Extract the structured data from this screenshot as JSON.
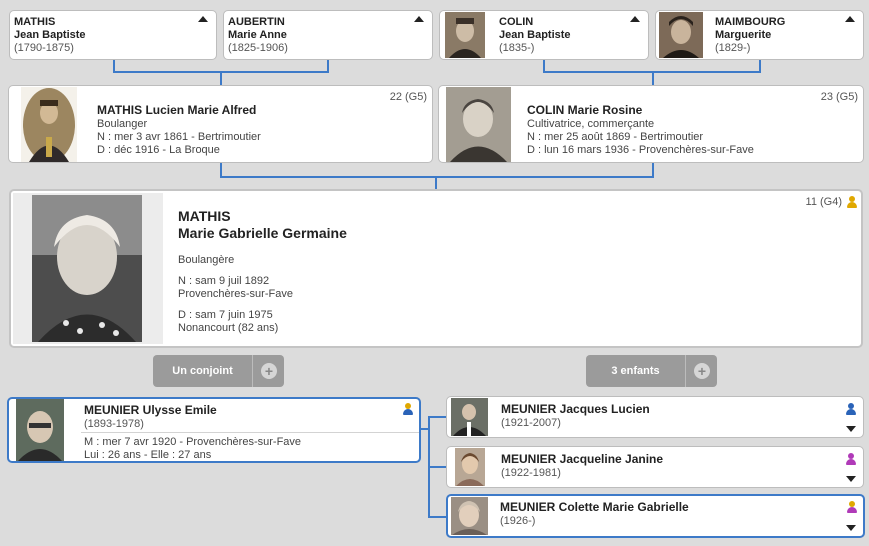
{
  "grandparents": [
    {
      "surname": "MATHIS",
      "given": "Jean Baptiste",
      "dates": "(1790-1875)"
    },
    {
      "surname": "AUBERTIN",
      "given": "Marie Anne",
      "dates": "(1825-1906)"
    },
    {
      "surname": "COLIN",
      "given": "Jean Baptiste",
      "dates": "(1835-)"
    },
    {
      "surname": "MAIMBOURG",
      "given": "Marguerite",
      "dates": "(1829-)"
    }
  ],
  "father": {
    "name": "MATHIS Lucien Marie Alfred",
    "occupation": "Boulanger",
    "birth": "N : mer 3 avr 1861 - Bertrimoutier",
    "death": "D : déc 1916 - La Broque",
    "number": "22 (G5)"
  },
  "mother": {
    "name": "COLIN Marie Rosine",
    "occupation": "Cultivatrice, commerçante",
    "birth": "N : mer 25 août 1869 - Bertrimoutier",
    "death": "D : lun 16 mars 1936 - Provenchères-sur-Fave",
    "number": "23 (G5)"
  },
  "main": {
    "surname": "MATHIS",
    "given": "Marie Gabrielle Germaine",
    "occupation": "Boulangère",
    "birth_date": "N : sam 9 juil 1892",
    "birth_place": "Provenchères-sur-Fave",
    "death_date": "D : sam 7 juin 1975",
    "death_place": "Nonancourt (82 ans)",
    "number": "11 (G4)"
  },
  "spouse_tab": {
    "label": "Un conjoint",
    "add": "+"
  },
  "children_tab": {
    "label": "3 enfants",
    "add": "+"
  },
  "spouse": {
    "name": "MEUNIER Ulysse Emile",
    "dates": "(1893-1978)",
    "marriage": "M : mer 7 avr 1920 - Provenchères-sur-Fave",
    "ages": "Lui : 26 ans - Elle : 27 ans"
  },
  "children": [
    {
      "name": "MEUNIER Jacques Lucien",
      "dates": "(1921-2007)"
    },
    {
      "name": "MEUNIER Jacqueline Janine",
      "dates": "(1922-1981)"
    },
    {
      "name": "MEUNIER Colette Marie Gabrielle",
      "dates": "(1926-)"
    }
  ],
  "colors": {
    "connector": "#3d7ac8",
    "male": "#2a63b8",
    "female": "#b03ab8",
    "main_person": "#e0a800"
  }
}
